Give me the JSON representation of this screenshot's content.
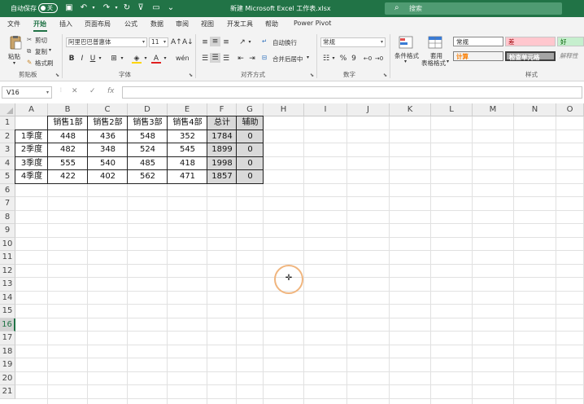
{
  "titlebar": {
    "autosave_label": "自动保存",
    "autosave_state": "关",
    "doc_title": "新建 Microsoft Excel 工作表.xlsx",
    "search_placeholder": "搜索"
  },
  "tabs": [
    "文件",
    "开始",
    "插入",
    "页面布局",
    "公式",
    "数据",
    "审阅",
    "视图",
    "开发工具",
    "帮助",
    "Power Pivot"
  ],
  "active_tab": "开始",
  "ribbon": {
    "clipboard": {
      "paste": "粘贴",
      "cut": "剪切",
      "copy": "复制",
      "format_painter": "格式刷",
      "label": "剪贴板"
    },
    "font": {
      "font_name": "阿里巴巴普惠体",
      "font_size": "11",
      "bold": "B",
      "italic": "I",
      "underline": "U",
      "label": "字体"
    },
    "alignment": {
      "wrap": "自动换行",
      "merge": "合并后居中",
      "label": "对齐方式"
    },
    "number": {
      "format": "常规",
      "label": "数字",
      "percent": "%",
      "comma": "9"
    },
    "styles": {
      "conditional": "条件格式",
      "table_format_1": "套用",
      "table_format_2": "表格格式",
      "label": "样式",
      "cells": [
        "常规",
        "差",
        "好",
        "计算",
        "检查单元格",
        "解释性"
      ]
    }
  },
  "formula_bar": {
    "name_box": "V16",
    "cancel": "✕",
    "enter": "✓",
    "fx": "fx",
    "formula": ""
  },
  "sheet": {
    "columns": [
      "A",
      "B",
      "C",
      "D",
      "E",
      "F",
      "G",
      "H",
      "I",
      "J",
      "K",
      "L",
      "M",
      "N",
      "O"
    ],
    "rows": [
      "1",
      "2",
      "3",
      "4",
      "5",
      "6",
      "7",
      "8",
      "9",
      "10",
      "11",
      "12",
      "13",
      "14",
      "15",
      "16",
      "17",
      "18",
      "19",
      "20",
      "21"
    ],
    "active_row": "16",
    "table": {
      "headers": [
        "",
        "销售1部",
        "销售2部",
        "销售3部",
        "销售4部",
        "总计",
        "辅助"
      ],
      "data": [
        [
          "1季度",
          "448",
          "436",
          "548",
          "352",
          "1784",
          "0"
        ],
        [
          "2季度",
          "482",
          "348",
          "524",
          "545",
          "1899",
          "0"
        ],
        [
          "3季度",
          "555",
          "540",
          "485",
          "418",
          "1998",
          "0"
        ],
        [
          "4季度",
          "422",
          "402",
          "562",
          "471",
          "1857",
          "0"
        ]
      ]
    },
    "colors": {
      "highlight_fill": "#d9d9d9",
      "accent": "#217346"
    }
  }
}
